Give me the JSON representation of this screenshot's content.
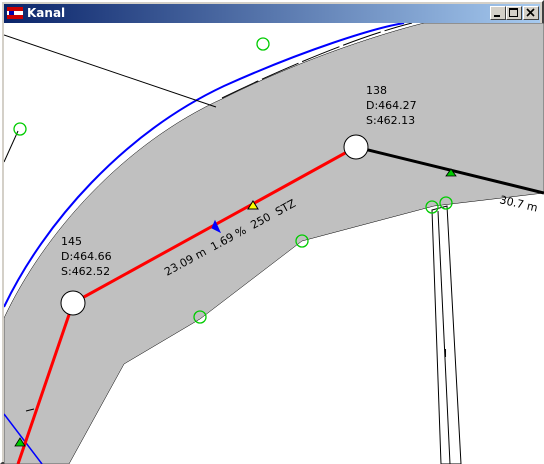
{
  "window": {
    "title": "Kanal",
    "controls": {
      "minimize": "minimize-icon",
      "maximize": "maximize-icon",
      "close": "close-icon"
    }
  },
  "map": {
    "nodes": [
      {
        "id": "138",
        "d_label": "D:464.27",
        "s_label": "S:462.13"
      },
      {
        "id": "145",
        "d_label": "D:464.66",
        "s_label": "S:462.52"
      }
    ],
    "segments": [
      {
        "label": "23.09 m  1.69 %  250  STZ",
        "color": "#ff0000"
      },
      {
        "label": "30.7 m",
        "color": "#000000"
      }
    ],
    "small_mark": "l",
    "colors": {
      "corridor": "#c0c0c0",
      "edge_line": "#0000ff",
      "pipe_red": "#ff0000",
      "pipe_black": "#000000",
      "marker_green": "#00cc00",
      "marker_yellow": "#ffff00",
      "flow_arrow": "#0000ff"
    }
  }
}
